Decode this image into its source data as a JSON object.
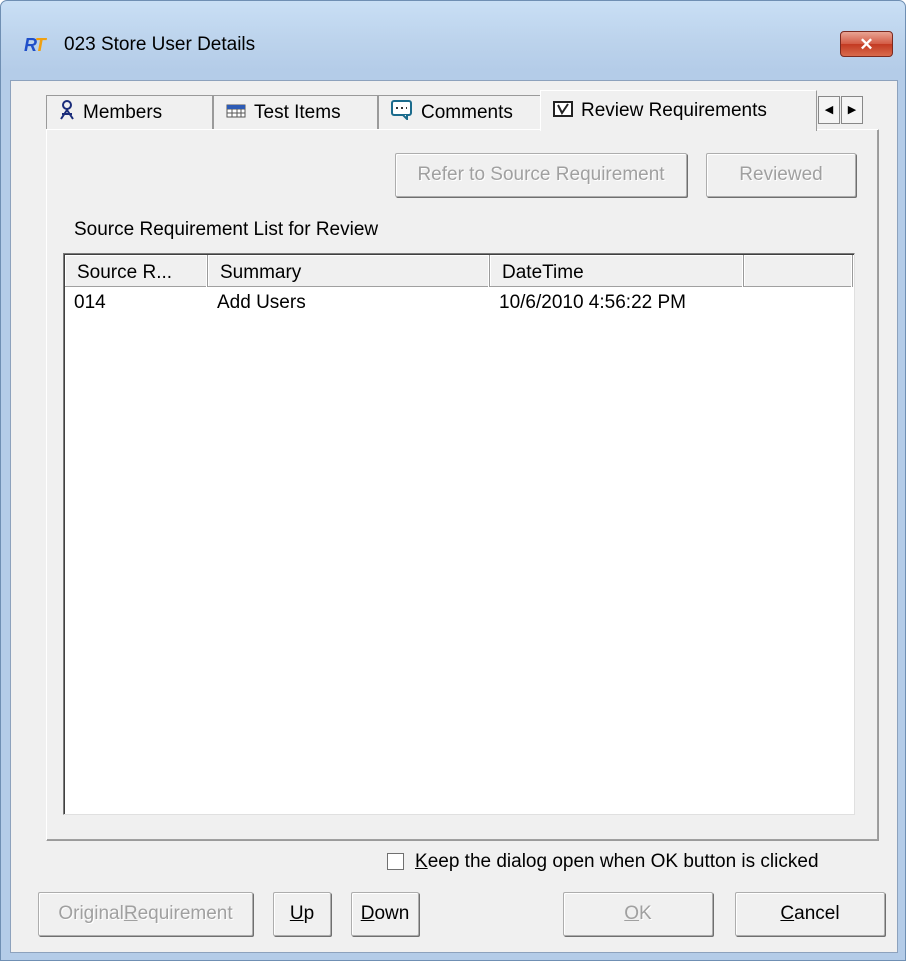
{
  "window": {
    "title": "023 Store User Details",
    "icon_text_left": "R",
    "icon_text_right": "T",
    "close_glyph": "✕"
  },
  "tabs": [
    {
      "label": "Members",
      "icon": "person-icon"
    },
    {
      "label": "Test Items",
      "icon": "grid-icon"
    },
    {
      "label": "Comments",
      "icon": "comment-icon"
    },
    {
      "label": "Review Requirements",
      "icon": "checkbox-icon",
      "active": true
    }
  ],
  "tab_scroll": {
    "left": "◀",
    "right": "▶"
  },
  "toolbar": {
    "refer_label": "Refer to Source Requirement",
    "reviewed_label": "Reviewed"
  },
  "list": {
    "caption": "Source Requirement List for Review",
    "columns": [
      "Source R...",
      "Summary",
      "DateTime",
      ""
    ],
    "rows": [
      {
        "source": "014",
        "summary": "Add Users",
        "datetime": "10/6/2010 4:56:22 PM"
      }
    ]
  },
  "keep_open": {
    "label_mnemonic": "K",
    "label_rest": "eep the dialog open when OK button is clicked",
    "checked": false
  },
  "footer": {
    "original_prefix": "Original ",
    "original_mnemonic": "R",
    "original_rest": "equirement",
    "up_mnemonic": "U",
    "up_rest": "p",
    "down_mnemonic": "D",
    "down_rest": "own",
    "ok_mnemonic": "O",
    "ok_rest": "K",
    "cancel_mnemonic": "C",
    "cancel_rest": "ancel"
  },
  "colors": {
    "frame": "#b9d1ea",
    "client_bg": "#f0f0f0",
    "disabled_text": "#a0a0a0",
    "close_button": "#c9452d"
  }
}
